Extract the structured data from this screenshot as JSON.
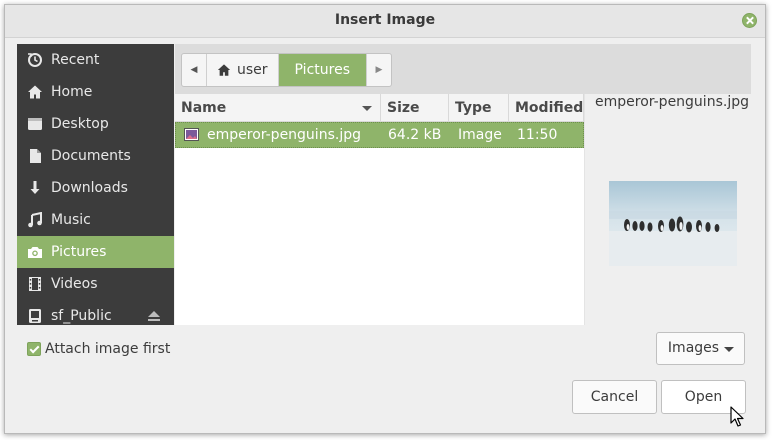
{
  "window": {
    "title": "Insert Image"
  },
  "sidebar": {
    "items": [
      {
        "label": "Recent",
        "icon": "clock-icon",
        "active": false
      },
      {
        "label": "Home",
        "icon": "home-icon",
        "active": false
      },
      {
        "label": "Desktop",
        "icon": "desktop-icon",
        "active": false
      },
      {
        "label": "Documents",
        "icon": "document-icon",
        "active": false
      },
      {
        "label": "Downloads",
        "icon": "download-icon",
        "active": false
      },
      {
        "label": "Music",
        "icon": "music-icon",
        "active": false
      },
      {
        "label": "Pictures",
        "icon": "camera-icon",
        "active": true
      },
      {
        "label": "Videos",
        "icon": "film-icon",
        "active": false
      },
      {
        "label": "sf_Public",
        "icon": "drive-icon",
        "active": false,
        "eject": true
      }
    ]
  },
  "pathbar": {
    "segments": [
      {
        "label": "user",
        "icon": "home-icon",
        "active": false
      },
      {
        "label": "Pictures",
        "active": true
      }
    ]
  },
  "filelist": {
    "columns": [
      {
        "label": "Name",
        "sorted": true
      },
      {
        "label": "Size"
      },
      {
        "label": "Type"
      },
      {
        "label": "Modified"
      }
    ],
    "rows": [
      {
        "name": "emperor-penguins.jpg",
        "size": "64.2 kB",
        "type": "Image",
        "modified": "11:50",
        "selected": true
      }
    ]
  },
  "preview": {
    "filename": "emperor-penguins.jpg"
  },
  "options": {
    "attach_label": "Attach image first",
    "attach_checked": true
  },
  "filter": {
    "selected": "Images"
  },
  "buttons": {
    "cancel": "Cancel",
    "open": "Open"
  },
  "colors": {
    "accent": "#8fb46a",
    "sidebar_bg": "#3c3c3c",
    "dialog_bg": "#efefef"
  }
}
